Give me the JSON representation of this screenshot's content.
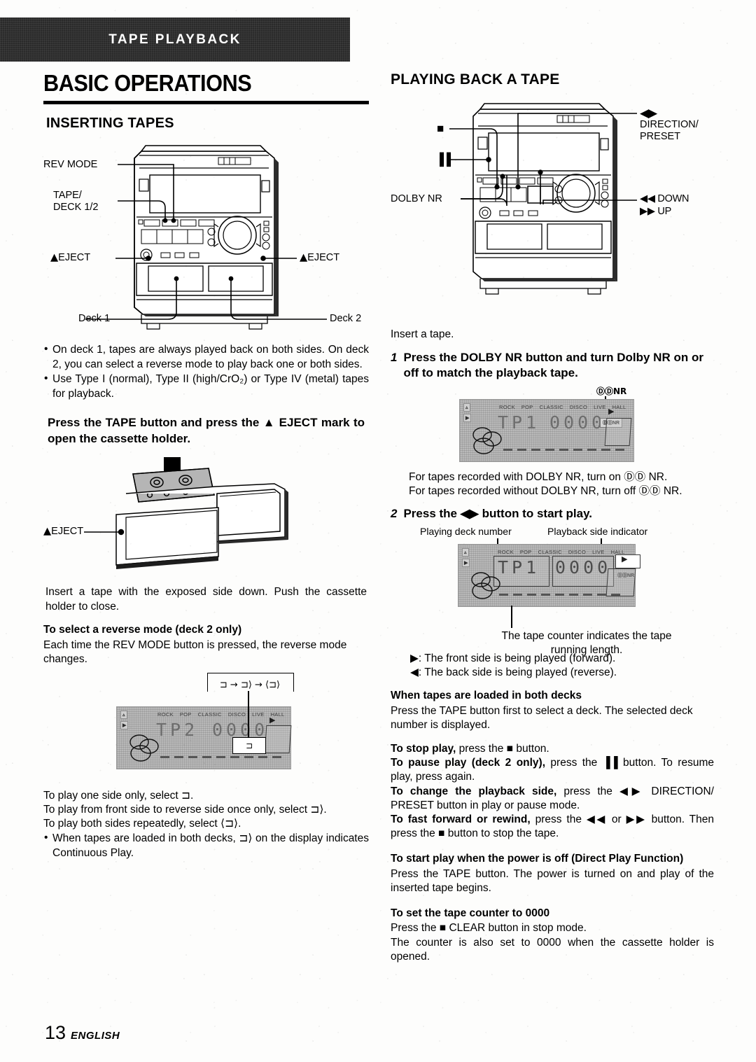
{
  "banner": {
    "label": "TAPE PLAYBACK"
  },
  "left": {
    "main_title": "BASIC OPERATIONS",
    "section_title": "INSERTING TAPES",
    "unit_callouts": {
      "rev_mode": "REV MODE",
      "tape_deck": "TAPE/\nDECK 1/2",
      "eject_left": "EJECT",
      "eject_right": "EJECT",
      "deck1": "Deck 1",
      "deck2": "Deck 2"
    },
    "bullets": [
      "On deck 1, tapes are always played back on both sides. On deck 2, you can select a reverse mode to play back one or both sides.",
      "Use Type I (normal), Type II (high/CrO₂) or Type IV (metal) tapes for playback."
    ],
    "press_tape_heading": "Press the TAPE button and press the ▲ EJECT mark to open the cassette holder.",
    "cassette_callout": "EJECT",
    "insert_text": "Insert a tape with the exposed side down. Push the cassette holder to close.",
    "reverse_heading": "To select a reverse mode (deck 2 only)",
    "reverse_text": "Each time the REV MODE button is pressed, the reverse mode changes.",
    "lcd": {
      "genres": [
        "ROCK",
        "POP",
        "CLASSIC",
        "DISCO",
        "LIVE",
        "HALL"
      ],
      "deck": "TP2",
      "counter": "0000",
      "mode_tag": "⊐",
      "cycle": "⊐ → ⊐⟩ → ⟨⊐⟩"
    },
    "mode_lines": [
      "To play one side only, select ⊐.",
      "To play from front side to reverse side once only, select ⊐⟩.",
      "To play both sides repeatedly, select ⟨⊐⟩."
    ],
    "continuous_bullet": "When tapes are loaded in both decks, ⊐⟩ on the display indicates Continuous Play."
  },
  "right": {
    "section_title": "PLAYING BACK A TAPE",
    "unit_callouts": {
      "stop": "■",
      "pause": "▐▐",
      "dolby_nr": "DOLBY NR",
      "direction": "◀▶",
      "direction_label": "DIRECTION/\nPRESET",
      "down": "◀◀ DOWN",
      "up": "▶▶ UP"
    },
    "insert_line": "Insert a tape.",
    "step1": {
      "num": "1",
      "text": "Press the DOLBY NR button and turn Dolby NR on or off to match the playback tape."
    },
    "lcd1": {
      "genres": [
        "ROCK",
        "POP",
        "CLASSIC",
        "DISCO",
        "LIVE",
        "HALL"
      ],
      "deck": "TP1",
      "counter": "0000",
      "dolby_callout": "ⒹⒹNR",
      "dolby_badge": "ⒹⒹNR"
    },
    "dolby_notes": [
      "For tapes recorded with DOLBY NR, turn on ⒹⒹ NR.",
      "For tapes recorded without DOLBY NR, turn off ⒹⒹ NR."
    ],
    "step2": {
      "num": "2",
      "text": "Press the ◀▶ button to start play."
    },
    "lcd2": {
      "label_deck": "Playing deck number",
      "label_side": "Playback side indicator",
      "genres": [
        "ROCK",
        "POP",
        "CLASSIC",
        "DISCO",
        "LIVE",
        "HALL"
      ],
      "deck": "TP1",
      "counter": "0000",
      "dolby_badge": "ⒹⒹNR",
      "caption": "The tape counter indicates the tape running length."
    },
    "side_notes": [
      "▶:  The front side is being played (forward).",
      "◀:  The back side is being played (reverse)."
    ],
    "both_decks_heading": "When tapes are loaded in both decks",
    "both_decks_text": "Press the TAPE button first to select a deck. The selected deck number is displayed.",
    "ops": [
      {
        "bold": "To stop play,",
        "rest": " press the ■ button."
      },
      {
        "bold": "To pause play (deck 2 only),",
        "rest": " press the ▐▐ button.  To resume play, press again."
      },
      {
        "bold": "To change the playback side,",
        "rest": " press the ◀▶ DIRECTION/ PRESET button in play or pause mode."
      },
      {
        "bold": "To fast forward or rewind,",
        "rest": " press the ◀◀ or ▶▶ button.  Then press the ■ button to stop the tape."
      }
    ],
    "direct_play_heading": "To start play when the power is off (Direct Play Function)",
    "direct_play_text": "Press the TAPE button.  The power is turned on and play of the inserted tape begins.",
    "counter_heading": "To set the tape counter to 0000",
    "counter_text_1": "Press the ■ CLEAR button in stop mode.",
    "counter_text_2": "The counter is also set to 0000 when the cassette holder is opened."
  },
  "footer": {
    "page_number": "13",
    "language": "ENGLISH"
  }
}
